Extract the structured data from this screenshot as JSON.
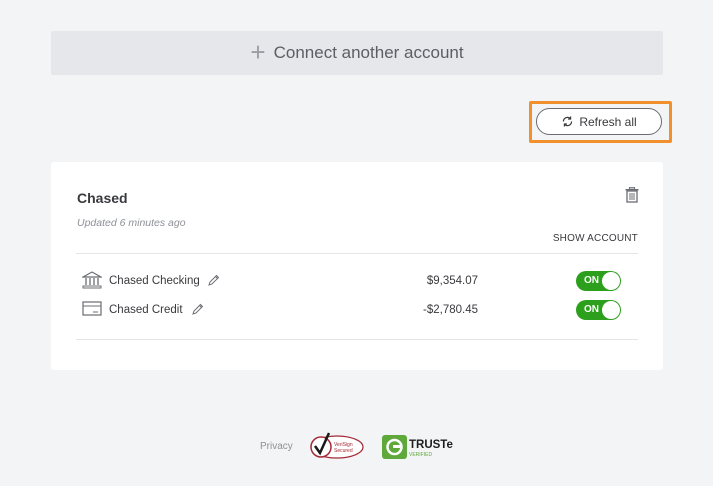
{
  "connect": {
    "plus": "+",
    "label": "Connect another account"
  },
  "toolbar": {
    "refresh_label": "Refresh all"
  },
  "bank": {
    "name": "Chased",
    "updated": "Updated 6 minutes ago",
    "show_account": "SHOW ACCOUNT",
    "accounts": [
      {
        "name": "Chased Checking",
        "amount": "$9,354.07",
        "toggle": "ON",
        "icon": "bank-icon"
      },
      {
        "name": "Chased Credit",
        "amount": "-$2,780.45",
        "toggle": "ON",
        "icon": "credit-card-icon"
      }
    ]
  },
  "footer": {
    "privacy": "Privacy",
    "verisign_line1": "VeriSign",
    "verisign_line2": "Secured",
    "truste": "TRUSTe",
    "truste_sub": "VERIFIED"
  },
  "colors": {
    "accent": "#2ca01c",
    "highlight": "#f1902c"
  }
}
